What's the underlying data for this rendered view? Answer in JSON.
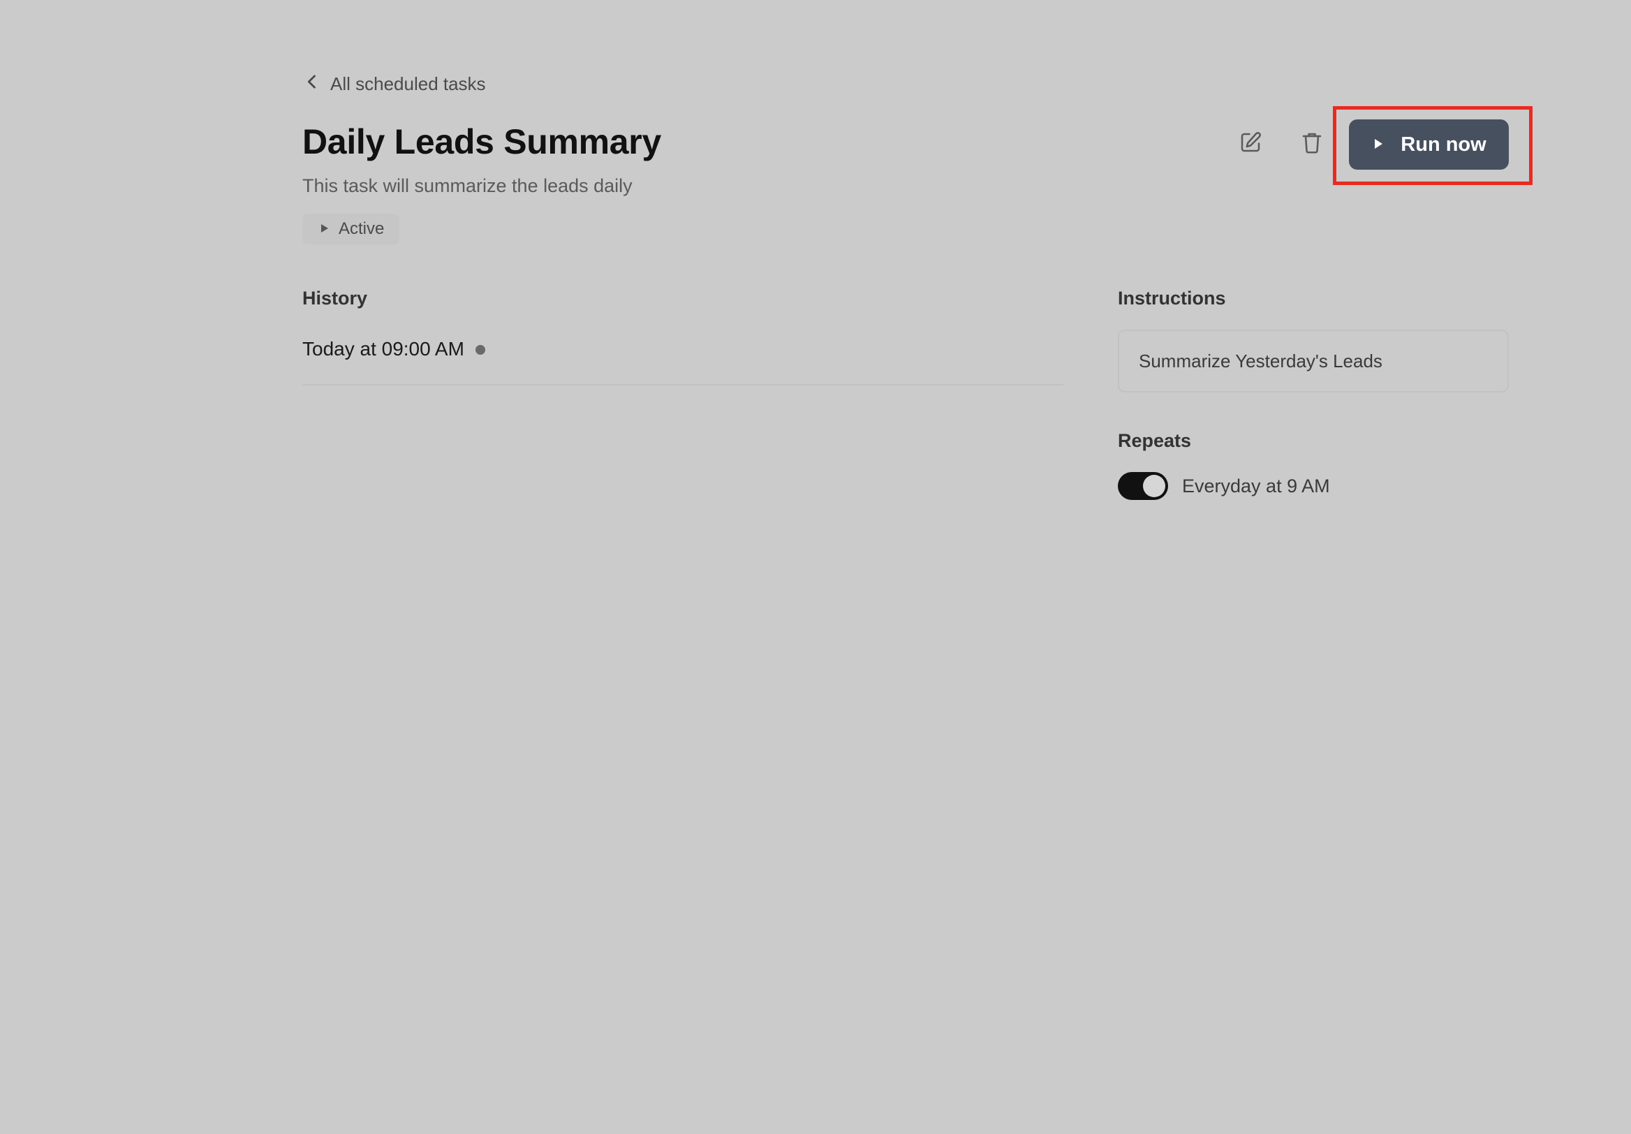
{
  "nav": {
    "back_label": "All scheduled tasks",
    "back_icon": "chevron-left-icon"
  },
  "task": {
    "title": "Daily Leads Summary",
    "description": "This task will summarize the leads daily",
    "status": "Active",
    "status_icon": "play-icon"
  },
  "actions": {
    "edit_icon": "edit-icon",
    "delete_icon": "trash-icon",
    "run_now_label": "Run now",
    "run_now_icon": "play-icon",
    "highlight_color": "#ea2a20"
  },
  "history": {
    "heading": "History",
    "entries": [
      {
        "time": "Today at 09:00 AM",
        "status_color": "#6a6a6a"
      }
    ]
  },
  "instructions": {
    "heading": "Instructions",
    "text": "Summarize Yesterday's Leads"
  },
  "repeats": {
    "heading": "Repeats",
    "enabled": true,
    "text": "Everyday at 9 AM"
  },
  "colors": {
    "background": "#cbcbcb",
    "primary_button": "#47505f",
    "toggle_on": "#111111"
  }
}
